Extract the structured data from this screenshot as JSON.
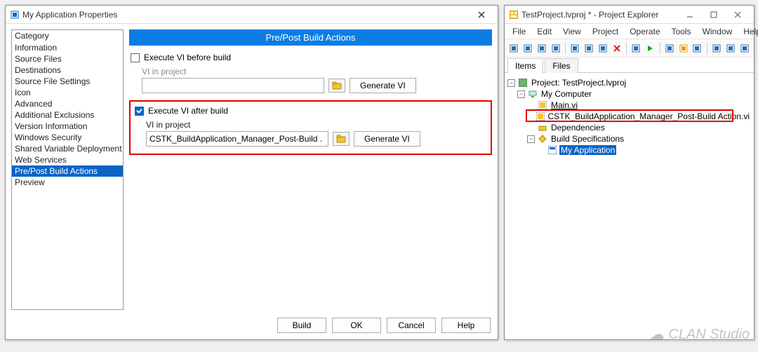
{
  "props": {
    "title": "My Application Properties",
    "category_header": "Category",
    "categories": [
      "Information",
      "Source Files",
      "Destinations",
      "Source File Settings",
      "Icon",
      "Advanced",
      "Additional Exclusions",
      "Version Information",
      "Windows Security",
      "Shared Variable Deployment",
      "Web Services",
      "Pre/Post Build Actions",
      "Preview"
    ],
    "selected_category_index": 11,
    "banner": "Pre/Post Build Actions",
    "before": {
      "checkbox_label": "Execute VI before build",
      "checked": false,
      "vi_label": "VI in project",
      "vi_value": "",
      "generate_label": "Generate  VI"
    },
    "after": {
      "checkbox_label": "Execute VI after build",
      "checked": true,
      "vi_label": "VI in project",
      "vi_value": "CSTK_BuildApplication_Manager_Post-Build .",
      "generate_label": "Generate  VI"
    },
    "buttons": {
      "build": "Build",
      "ok": "OK",
      "cancel": "Cancel",
      "help": "Help"
    }
  },
  "explorer": {
    "title": "TestProject.lvproj * - Project Explorer",
    "menu": [
      "File",
      "Edit",
      "View",
      "Project",
      "Operate",
      "Tools",
      "Window",
      "Help"
    ],
    "toolbar_icons": [
      "document-icon",
      "open-icon",
      "save-icon",
      "save-all-icon",
      "sep",
      "cut-icon",
      "copy-icon",
      "paste-icon",
      "delete-x-icon",
      "sep",
      "refresh-icon",
      "run-icon",
      "sep",
      "settings-gear-icon",
      "warning-icon",
      "find-icon",
      "sep",
      "hierarchy-icon",
      "deploy-icon",
      "build-icon"
    ],
    "tabs": {
      "items": "Items",
      "files": "Files",
      "active": 0
    },
    "tree": {
      "project": "Project: TestProject.lvproj",
      "my_computer": "My Computer",
      "main_vi": "Main.vi",
      "post_vi": "CSTK_BuildApplication_Manager_Post-Build Action.vi",
      "dependencies": "Dependencies",
      "build_specs": "Build Specifications",
      "my_app": "My Application"
    }
  },
  "watermark": "CLAN Studio"
}
